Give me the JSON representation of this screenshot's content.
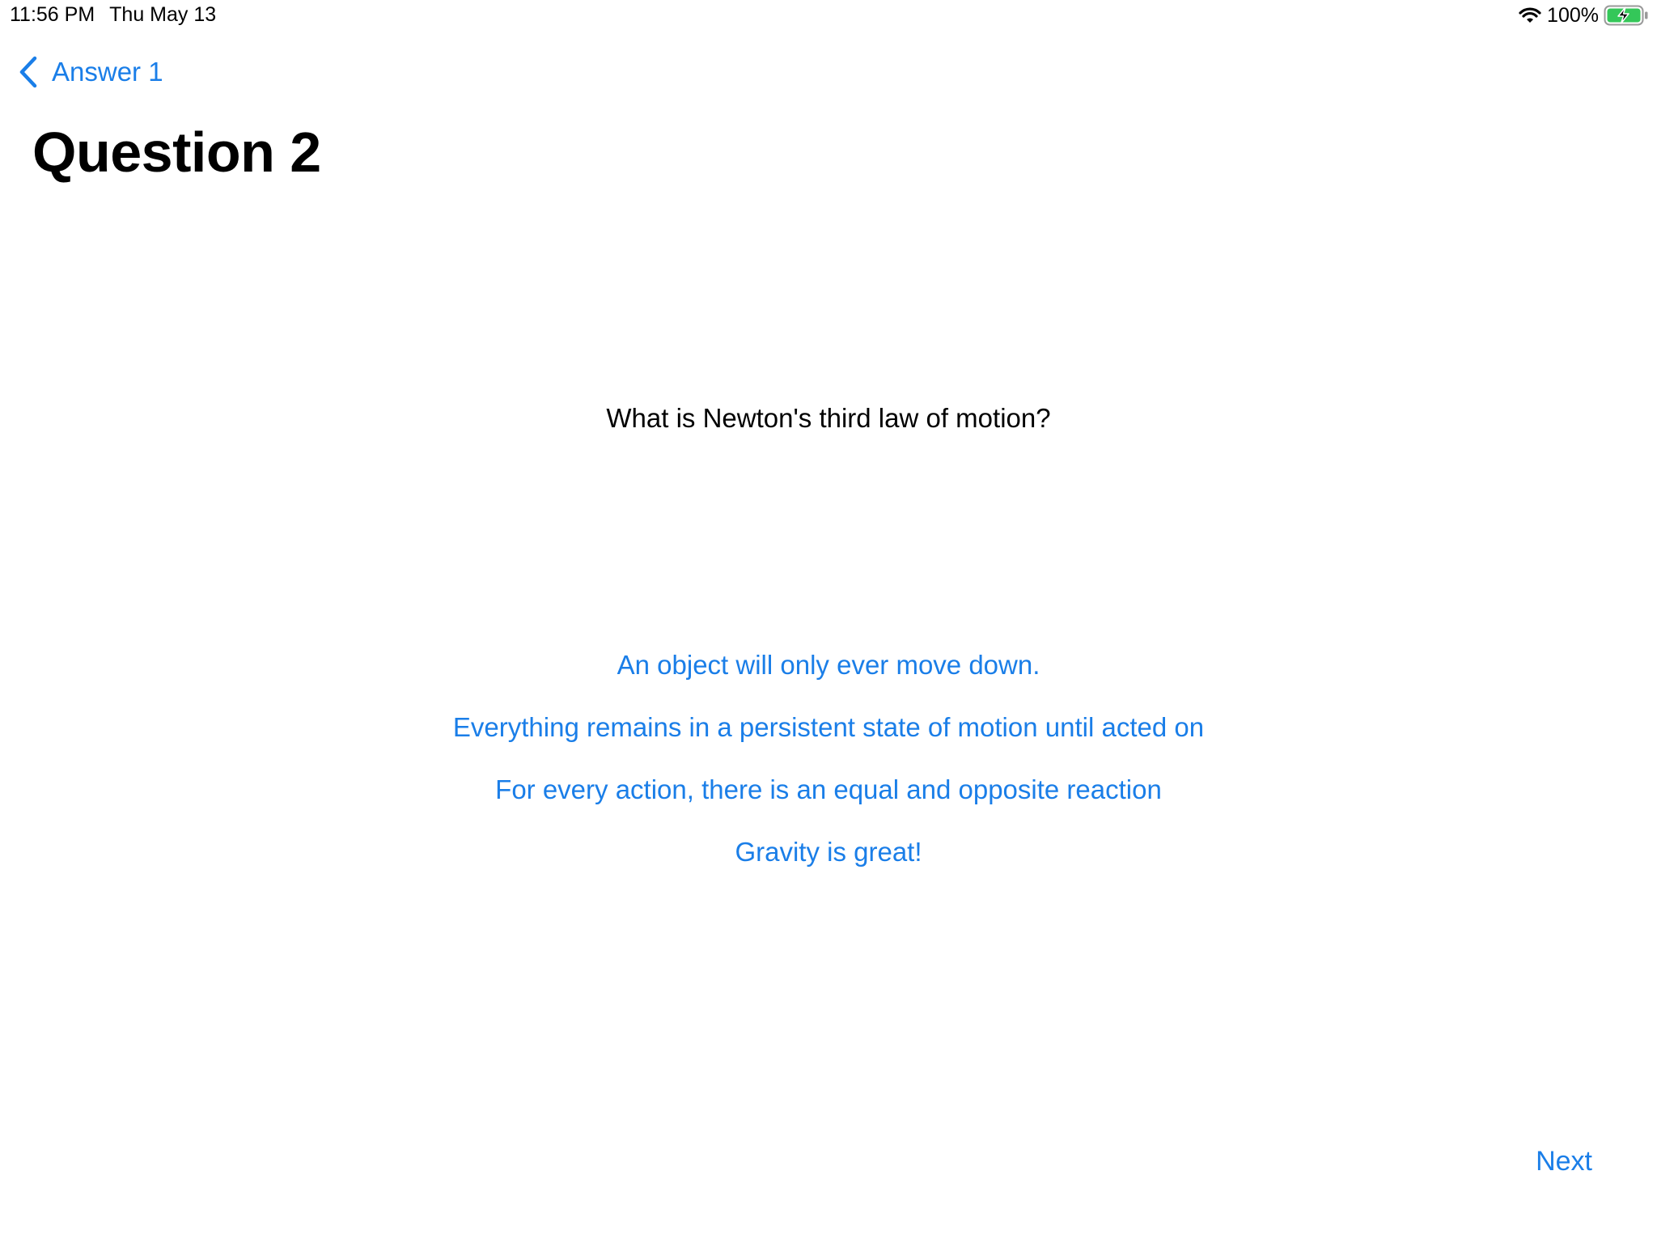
{
  "status_bar": {
    "time": "11:56 PM",
    "date": "Thu May 13",
    "battery_percent": "100%",
    "wifi_icon": "wifi-icon",
    "battery_icon": "battery-charging-icon",
    "battery_color": "#34c759"
  },
  "nav": {
    "back_label": "Answer 1",
    "back_icon": "chevron-left-icon",
    "title": "Question 2"
  },
  "question": {
    "text": "What is Newton's third law of motion?"
  },
  "answers": [
    {
      "label": "An object will only ever move down."
    },
    {
      "label": "Everything remains in a persistent state of motion until acted on"
    },
    {
      "label": "For every action, there is an equal and opposite reaction"
    },
    {
      "label": "Gravity is great!"
    }
  ],
  "footer": {
    "next_label": "Next"
  },
  "colors": {
    "accent": "#1a7ee8",
    "text": "#000000",
    "background": "#ffffff"
  }
}
